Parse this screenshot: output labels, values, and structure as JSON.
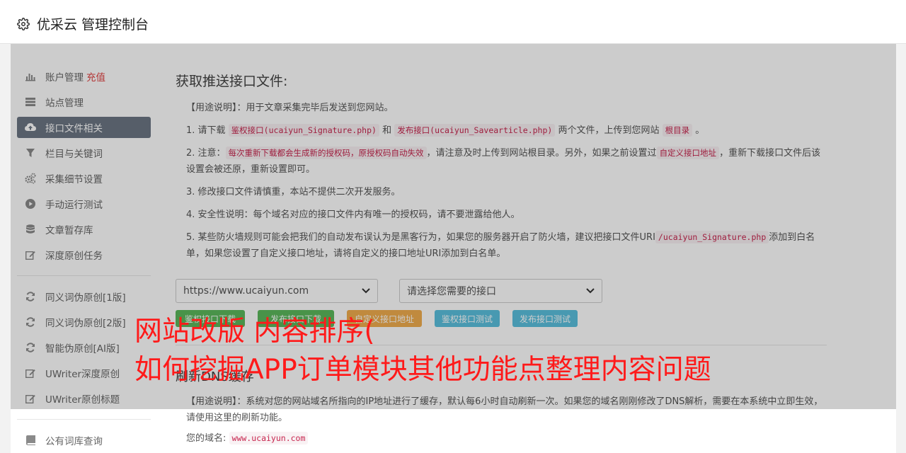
{
  "header": {
    "title": "优采云 管理控制台"
  },
  "sidebar": {
    "group1": [
      {
        "label": "账户管理",
        "extra": "充值",
        "icon": "bar-chart-icon"
      },
      {
        "label": "站点管理",
        "icon": "server-icon"
      },
      {
        "label": "接口文件相关",
        "icon": "cloud-upload-icon",
        "active": true
      },
      {
        "label": "栏目与关键词",
        "icon": "filter-icon"
      },
      {
        "label": "采集细节设置",
        "icon": "gears-icon"
      },
      {
        "label": "手动运行测试",
        "icon": "play-circle-icon"
      },
      {
        "label": "文章暂存库",
        "icon": "database-icon"
      },
      {
        "label": "深度原创任务",
        "icon": "edit-icon"
      }
    ],
    "group2": [
      {
        "label": "同义词伪原创[1版]",
        "icon": "refresh-icon"
      },
      {
        "label": "同义词伪原创[2版]",
        "icon": "refresh-icon"
      },
      {
        "label": "智能伪原创[AI版]",
        "icon": "refresh-icon"
      },
      {
        "label": "UWriter深度原创",
        "icon": "edit-icon"
      },
      {
        "label": "UWriter原创标题",
        "icon": "edit-icon"
      }
    ],
    "group3": [
      {
        "label": "公有词库查询",
        "icon": "book-icon"
      }
    ]
  },
  "main": {
    "title": "获取推送接口文件:",
    "usage": "【用途说明】：用于文章采集完毕后发送到您网站。",
    "step1": {
      "prefix": "1. 请下载",
      "code1": "鉴权接口(ucaiyun_Signature.php)",
      "mid": "和",
      "code2": "发布接口(ucaiyun_Savearticle.php)",
      "mid2": "两个文件，上传到您网站",
      "code3": "根目录",
      "suffix": "。"
    },
    "step2": {
      "prefix": "2. 注意：",
      "code1": "每次重新下载都会生成新的授权码，原授权码自动失效",
      "mid": "，请注意及时上传到网站根目录。另外，如果之前设置过",
      "code2": "自定义接口地址",
      "suffix": "，重新下载接口文件后该设置会被还原，重新设置即可。"
    },
    "step3": "3. 修改接口文件请慎重，本站不提供二次开发服务。",
    "step4": "4. 安全性说明：每个域名对应的接口文件内有唯一的授权码，请不要泄露给他人。",
    "step5": {
      "prefix": "5. 某些防火墙规则可能会把我们的自动发布误认为是黑客行为，如果您的服务器开启了防火墙，建议把接口文件URI",
      "code1": "/ucaiyun_Signature.php",
      "suffix": "添加到白名单，如果您设置了自定义接口地址，请将自定义的接口地址URI添加到白名单。"
    },
    "select_site": "https://www.ucaiyun.com",
    "select_api": "请选择您需要的接口",
    "buttons": {
      "download_sig": "鉴权接口下载",
      "download_pub": "发布接口下载",
      "custom_addr": "自定义接口地址",
      "test_sig": "鉴权接口测试",
      "test_pub": "发布接口测试"
    },
    "section2_title": "刷新DNS缓存",
    "section2_usage": "【用途说明】：系统对您的网站域名所指向的IP地址进行了缓存，默认每6小时自动刷新一次。如果您的域名刚刚修改了DNS解析，需要在本系统中立即生效，请使用这里的刷新功能。",
    "domain_label": "您的域名:",
    "domain_value": "www.ucaiyun.com"
  },
  "watermark": {
    "line1": "网站改版 内容排序(",
    "line2": "如何挖掘APP订单模块其他功能点整理内容问题"
  },
  "colors": {
    "active_bg": "#6c7684",
    "watermark": "#ff1a1a",
    "code_text": "#c7254e"
  }
}
